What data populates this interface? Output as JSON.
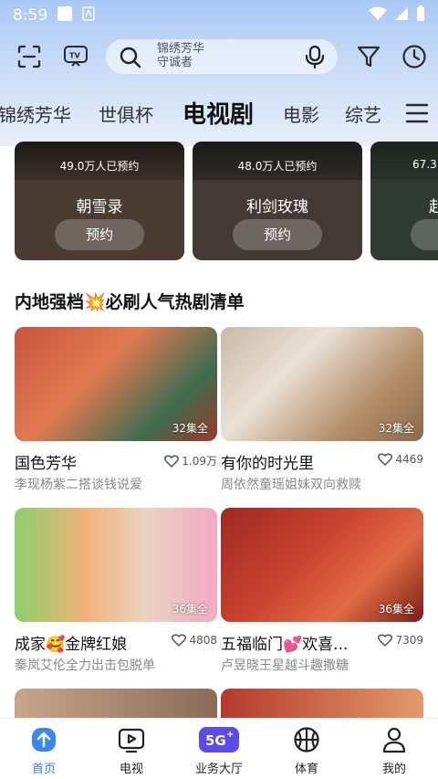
{
  "status": {
    "time": "8:59"
  },
  "search": {
    "placeholder_line1": "锦绣芳华",
    "placeholder_line2": "守诚者"
  },
  "tabs": [
    "锦绣芳华",
    "世俱杯",
    "电视剧",
    "电影",
    "综艺"
  ],
  "active_tab": "电视剧",
  "preorders": [
    {
      "count": "49.0万人已预约",
      "title": "朝雪录",
      "button": "预约",
      "color": "#4a3b33"
    },
    {
      "count": "48.0万人已预约",
      "title": "利剑玫瑰",
      "button": "预约",
      "color": "#433a36"
    },
    {
      "count": "67.3",
      "title": "赴",
      "button": "",
      "color": "#2f3a34"
    }
  ],
  "section": {
    "title": "内地强档💥必刷人气热剧清单"
  },
  "dramas": [
    {
      "title": "国色芳华",
      "likes": "1.09万",
      "episodes": "32集全",
      "subtitle": "李现杨紫二搭谈钱说爱"
    },
    {
      "title": "有你的时光里",
      "likes": "4469",
      "episodes": "32集全",
      "subtitle": "周依然童瑶姐妹双向救赎"
    },
    {
      "title": "成家🥰金牌红娘",
      "likes": "4808",
      "episodes": "36集全",
      "subtitle": "秦岚艾伦全力出击包脱单"
    },
    {
      "title": "五福临门💕欢喜...",
      "likes": "7309",
      "episodes": "36集全",
      "subtitle": "卢昱晓王星越斗趣撒糖"
    }
  ],
  "nav": [
    {
      "label": "首页",
      "icon": "home-icon",
      "active": true
    },
    {
      "label": "电视",
      "icon": "tv-play-icon",
      "active": false
    },
    {
      "label": "业务大厅",
      "icon": "5g-icon",
      "active": false
    },
    {
      "label": "体育",
      "icon": "basketball-icon",
      "active": false
    },
    {
      "label": "我的",
      "icon": "person-icon",
      "active": false
    }
  ]
}
